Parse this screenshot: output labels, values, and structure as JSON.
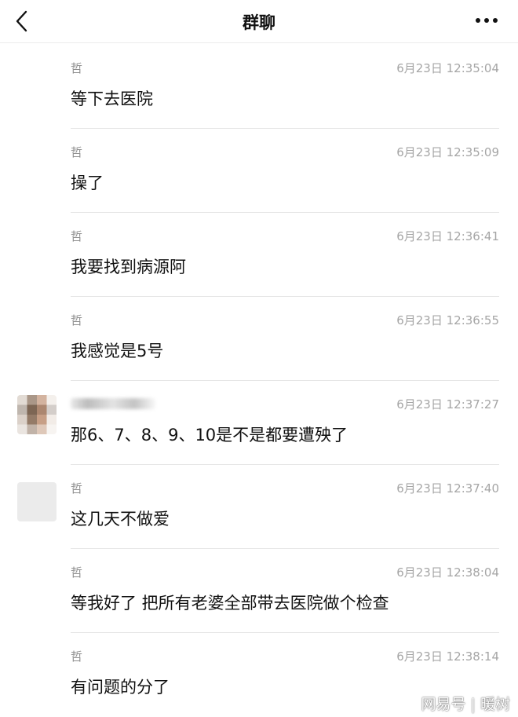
{
  "header": {
    "title": "群聊",
    "back_icon": "chevron-left-icon",
    "more_icon": "more-dots-icon"
  },
  "messages": [
    {
      "sender": "哲",
      "time": "6月23日 12:35:04",
      "text": "等下去医院"
    },
    {
      "sender": "哲",
      "time": "6月23日 12:35:09",
      "text": "操了"
    },
    {
      "sender": "哲",
      "time": "6月23日 12:36:41",
      "text": "我要找到病源阿"
    },
    {
      "sender": "哲",
      "time": "6月23日 12:36:55",
      "text": "我感觉是5号"
    },
    {
      "sender": "",
      "time": "6月23日 12:37:27",
      "text": "那6、7、8、9、10是不是都要遭殃了"
    },
    {
      "sender": "哲",
      "time": "6月23日 12:37:40",
      "text": "这几天不做爱"
    },
    {
      "sender": "哲",
      "time": "6月23日 12:38:04",
      "text": "等我好了 把所有老婆全部带去医院做个检查"
    },
    {
      "sender": "哲",
      "time": "6月23日 12:38:14",
      "text": "有问题的分了"
    }
  ],
  "watermark": "网易号 | 暖树"
}
